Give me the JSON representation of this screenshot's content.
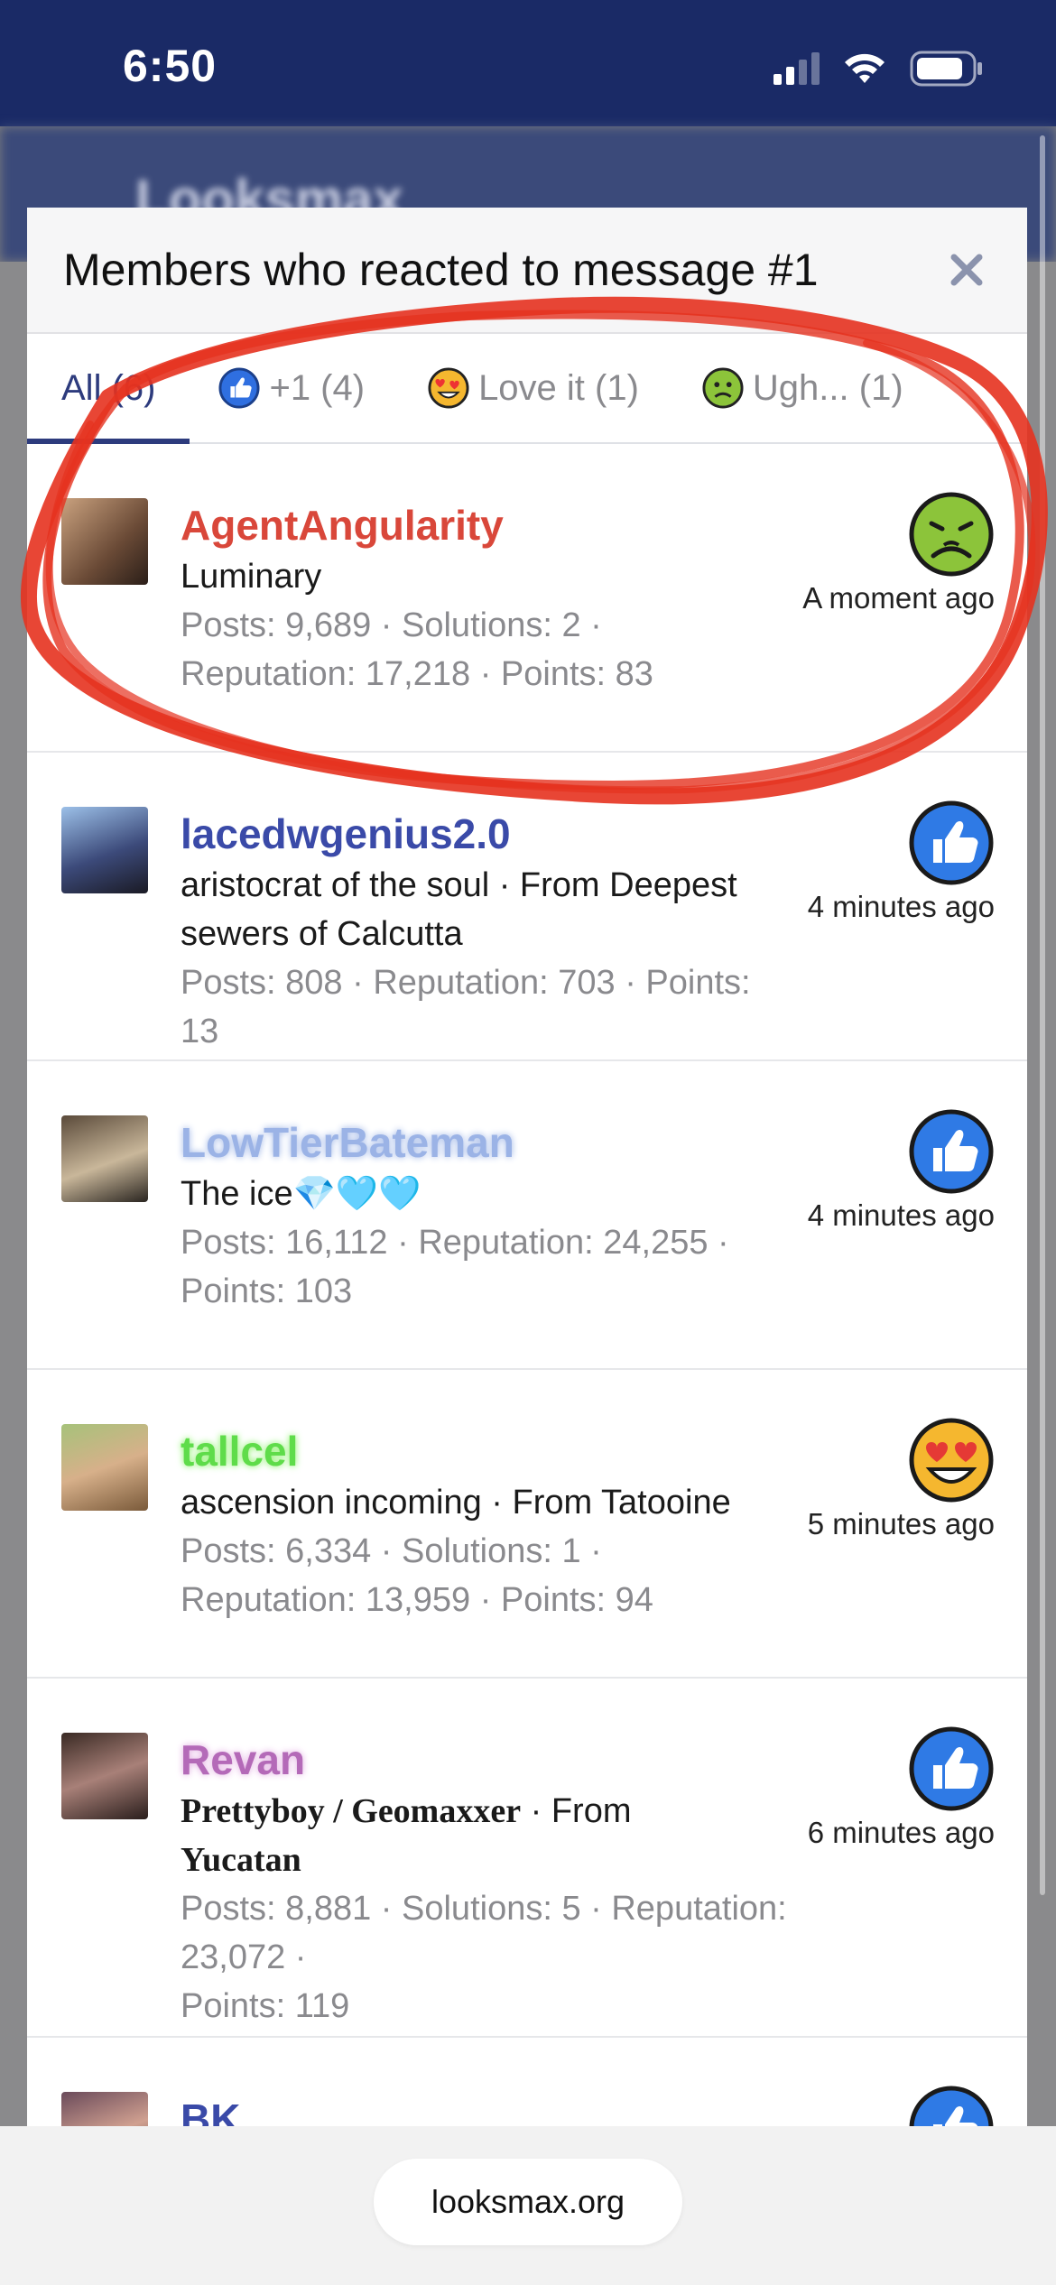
{
  "status_bar": {
    "time": "6:50"
  },
  "background_app": {
    "logo": "Looksmax"
  },
  "modal": {
    "title": "Members who reacted to message #1",
    "close_label": "×",
    "tabs": [
      {
        "label": "All (6)",
        "icon": "none",
        "active": true
      },
      {
        "label": "+1 (4)",
        "icon": "thumbs-up-icon",
        "active": false
      },
      {
        "label": "Love it (1)",
        "icon": "heart-eyes-icon",
        "active": false
      },
      {
        "label": "Ugh... (1)",
        "icon": "nauseated-icon",
        "active": false
      }
    ]
  },
  "members": [
    {
      "name": "AgentAngularity",
      "name_color": "#d9473a",
      "title": "Luminary",
      "stats_line1": "Posts: 9,689 · Solutions: 2 ·",
      "stats_line2": "Reputation: 17,218 · Points: 83",
      "reaction": "nauseated-icon",
      "time": "A moment ago"
    },
    {
      "name": "lacedwgenius2.0",
      "name_color": "#3a4aa8",
      "title_line1": "aristocrat of the soul · From Deepest",
      "title_line2": "sewers of Calcutta",
      "stats_line1": "Posts: 808 · Reputation: 703 · Points: 13",
      "reaction": "thumbs-up-icon",
      "time": "4 minutes ago"
    },
    {
      "name": "LowTierBateman",
      "name_color": "#9bb3e6",
      "title": "The ice💎🩵🩵",
      "stats_line1": "Posts: 16,112 · Reputation: 24,255 ·",
      "stats_line2": "Points: 103",
      "reaction": "thumbs-up-icon",
      "time": "4 minutes ago"
    },
    {
      "name": "tallcel",
      "name_color": "#5fdc4a",
      "title": "ascension incoming · From Tatooine",
      "stats_line1": "Posts: 6,334 · Solutions: 1 ·",
      "stats_line2": "Reputation: 13,959 · Points: 94",
      "reaction": "heart-eyes-icon",
      "time": "5 minutes ago"
    },
    {
      "name": "Revan",
      "name_color": "#b46ab8",
      "title_bold": "Prettyboy / Geomaxxer",
      "title_from": " · From",
      "title_line2": "Yucatan",
      "stats_line1": "Posts: 8,881 · Solutions: 5 · Reputation: 23,072 ·",
      "stats_line2": "Points: 119",
      "reaction": "thumbs-up-icon",
      "time": "6 minutes ago"
    },
    {
      "name": "BK",
      "name_color": "#3a4aa8",
      "reaction": "thumbs-up-icon"
    }
  ],
  "url_bar": {
    "domain": "looksmax.org"
  },
  "colors": {
    "status_bar": "#1a2a66",
    "accent": "#2d3b7d",
    "annotation": "#e5321f"
  }
}
